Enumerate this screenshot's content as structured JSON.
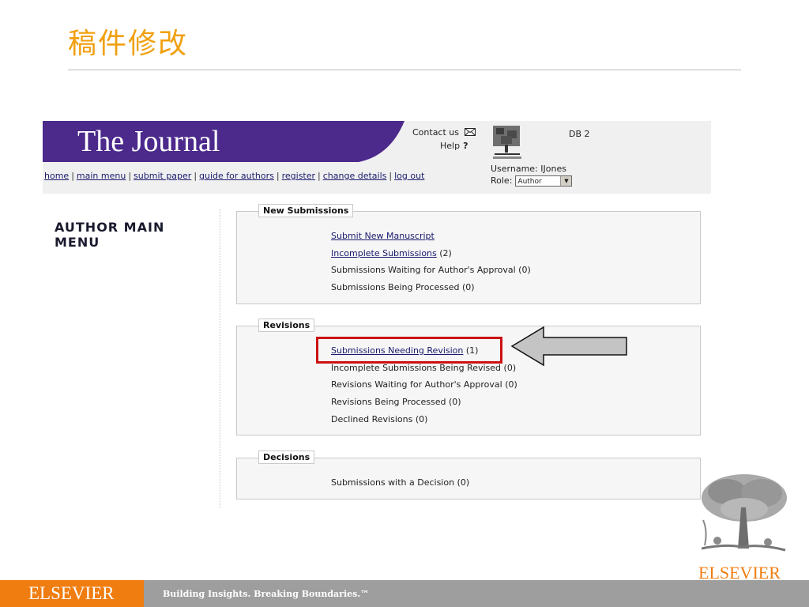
{
  "slide": {
    "title": "稿件修改",
    "footer_brand": "ELSEVIER",
    "footer_tagline": "Building Insights. Breaking Boundaries.™",
    "corner_brand": "ELSEVIER"
  },
  "colors": {
    "accent_orange": "#f07d10",
    "title_orange": "#f0a010",
    "banner_purple": "#4b2a8c",
    "highlight_red": "#cc1111"
  },
  "journal": {
    "title": "The Journal",
    "contact_label": "Contact us",
    "help_label": "Help",
    "db_label": "DB 2",
    "username_label": "Username:",
    "username_value": "IJones",
    "role_label": "Role:",
    "role_value": "Author"
  },
  "nav": {
    "items": [
      "home",
      "main menu",
      "submit paper",
      "guide for authors",
      "register",
      "change details",
      "log out"
    ]
  },
  "menu": {
    "heading": "AUTHOR MAIN MENU"
  },
  "sections": {
    "new": {
      "legend": "New Submissions",
      "items": [
        {
          "label": "Submit New Manuscript",
          "count": ""
        },
        {
          "label": "Incomplete Submissions",
          "count": " (2)"
        },
        {
          "label": "Submissions Waiting for Author's Approval",
          "count": " (0)"
        },
        {
          "label": "Submissions Being Processed",
          "count": " (0)"
        }
      ]
    },
    "revisions": {
      "legend": "Revisions",
      "items": [
        {
          "label": "Submissions Needing Revision",
          "count": " (1)"
        },
        {
          "label": "Incomplete Submissions Being Revised",
          "count": " (0)"
        },
        {
          "label": "Revisions Waiting for Author's Approval",
          "count": " (0)"
        },
        {
          "label": "Revisions Being Processed",
          "count": " (0)"
        },
        {
          "label": "Declined Revisions",
          "count": " (0)"
        }
      ]
    },
    "decisions": {
      "legend": "Decisions",
      "items": [
        {
          "label": "Submissions with a Decision",
          "count": " (0)"
        }
      ]
    }
  },
  "icons": {
    "contact": "envelope-icon",
    "help": "question-mark-icon",
    "logo": "elsevier-tree-logo",
    "pointer": "left-arrow-icon"
  }
}
